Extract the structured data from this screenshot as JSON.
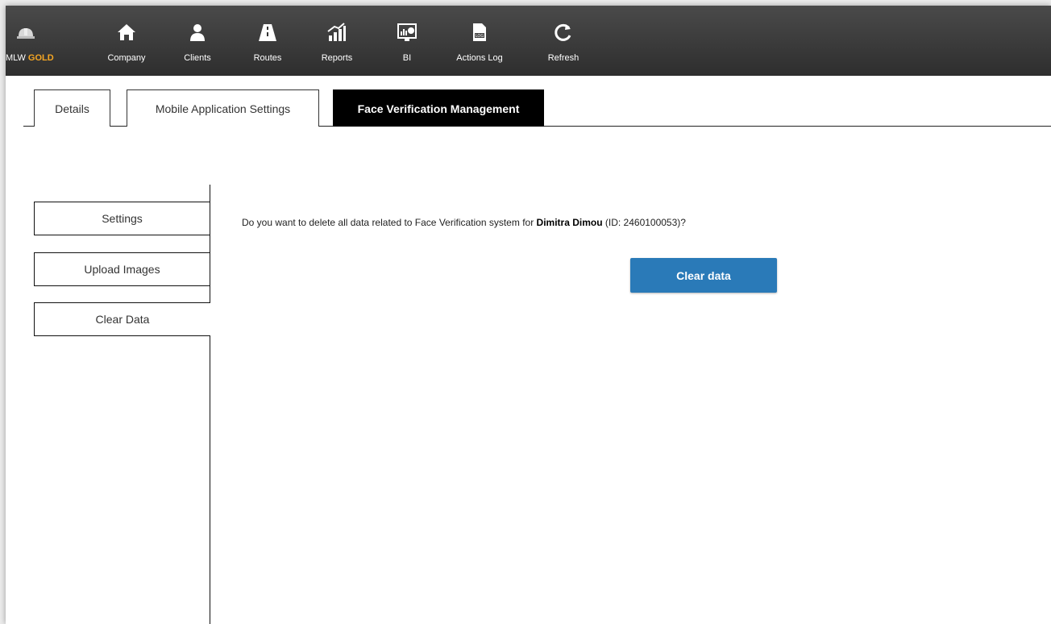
{
  "navbar": {
    "brand": {
      "prefix": "MLW",
      "suffix": "GOLD",
      "icon": "hard-hat-icon"
    },
    "items": [
      {
        "label": "Company",
        "icon": "home-icon"
      },
      {
        "label": "Clients",
        "icon": "user-icon"
      },
      {
        "label": "Routes",
        "icon": "road-icon"
      },
      {
        "label": "Reports",
        "icon": "bar-chart-icon"
      },
      {
        "label": "BI",
        "icon": "dashboard-icon"
      },
      {
        "label": "Actions Log",
        "icon": "log-file-icon"
      },
      {
        "label": "Refresh",
        "icon": "refresh-icon"
      }
    ]
  },
  "tabs": [
    {
      "label": "Details",
      "active": false
    },
    {
      "label": "Mobile Application Settings",
      "active": false
    },
    {
      "label": "Face Verification Management",
      "active": true
    }
  ],
  "side_menu": [
    {
      "label": "Settings",
      "active": false
    },
    {
      "label": "Upload Images",
      "active": false
    },
    {
      "label": "Clear Data",
      "active": true
    }
  ],
  "main": {
    "prompt_before": "Do you want to delete all data related to Face Verification system for ",
    "person_name": "Dimitra Dimou",
    "prompt_after": " (ID: 2460100053)?",
    "clear_button_label": "Clear data"
  },
  "colors": {
    "navbar": "#3a3a3a",
    "brand_accent": "#f5a623",
    "active_tab": "#000000",
    "primary_button": "#2a7ab8"
  }
}
